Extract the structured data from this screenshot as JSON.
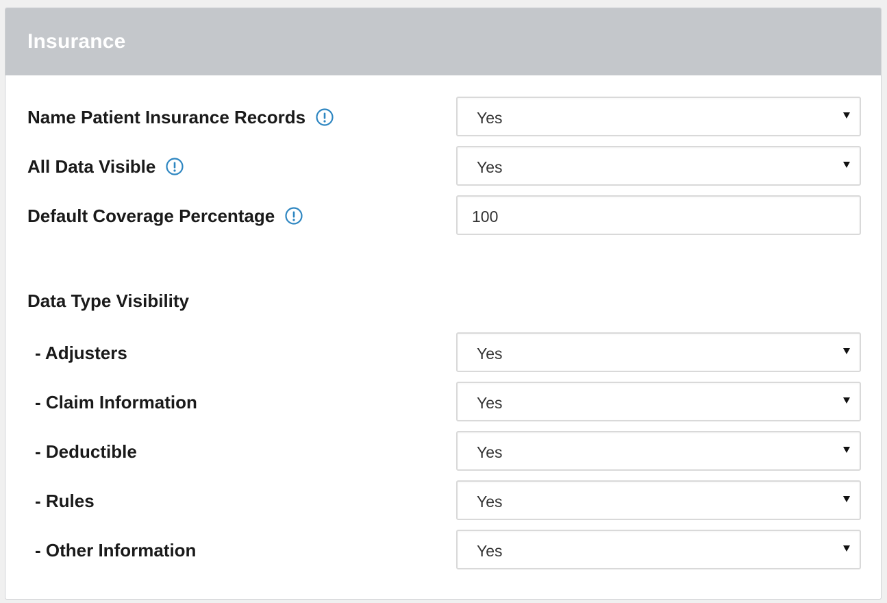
{
  "panel": {
    "title": "Insurance"
  },
  "settings": [
    {
      "label": "Name Patient Insurance Records",
      "value": "Yes",
      "type": "select",
      "icon": "info-icon"
    },
    {
      "label": "All Data Visible",
      "value": "Yes",
      "type": "select",
      "icon": "info-icon"
    },
    {
      "label": "Default Coverage Percentage",
      "value": "100",
      "type": "input",
      "icon": "info-icon"
    }
  ],
  "data_type_visibility": {
    "heading": "Data Type Visibility",
    "items": [
      {
        "label": "- Adjusters",
        "value": "Yes"
      },
      {
        "label": "- Claim Information",
        "value": "Yes"
      },
      {
        "label": "- Deductible",
        "value": "Yes"
      },
      {
        "label": "- Rules",
        "value": "Yes"
      },
      {
        "label": "- Other Information",
        "value": "Yes"
      }
    ]
  },
  "colors": {
    "header_bg": "#c4c7cb",
    "info_icon": "#2e86c1",
    "border": "#d9d9d9"
  }
}
